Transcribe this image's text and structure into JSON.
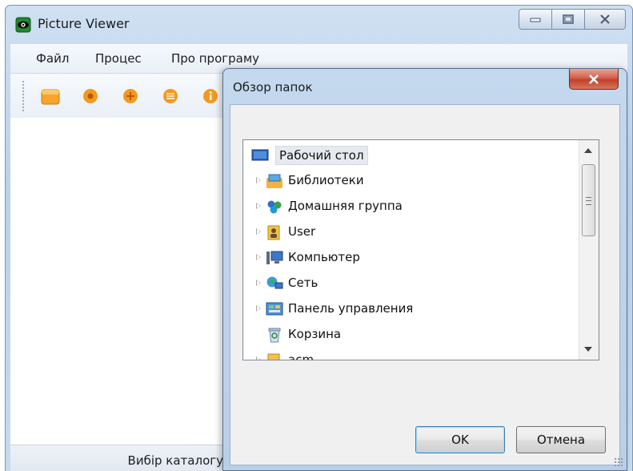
{
  "main_window": {
    "title": "Picture Viewer",
    "menu": [
      "Файл",
      "Процес",
      "Про програму"
    ],
    "toolbar_icons": [
      "folder-icon",
      "record-icon",
      "plus-circle-icon",
      "list-circle-icon",
      "info-icon"
    ],
    "status_text": "Вибір каталогу"
  },
  "dialog": {
    "title": "Обзор папок",
    "tree": [
      {
        "label": "Рабочий стол",
        "icon": "desktop-icon",
        "expandable": false,
        "selected": true,
        "root": true
      },
      {
        "label": "Библиотеки",
        "icon": "libraries-icon",
        "expandable": true
      },
      {
        "label": "Домашняя группа",
        "icon": "homegroup-icon",
        "expandable": true
      },
      {
        "label": "User",
        "icon": "user-folder-icon",
        "expandable": true
      },
      {
        "label": "Компьютер",
        "icon": "computer-icon",
        "expandable": true
      },
      {
        "label": "Сеть",
        "icon": "network-icon",
        "expandable": true
      },
      {
        "label": "Панель управления",
        "icon": "control-panel-icon",
        "expandable": true
      },
      {
        "label": "Корзина",
        "icon": "recycle-bin-icon",
        "expandable": false
      },
      {
        "label": "acm",
        "icon": "folder-icon",
        "expandable": true
      }
    ],
    "ok_label": "OK",
    "cancel_label": "Отмена"
  },
  "colors": {
    "accent": "#3c7fb1",
    "close_red": "#c2402a",
    "toolbar_orange": "#f39a1e"
  }
}
